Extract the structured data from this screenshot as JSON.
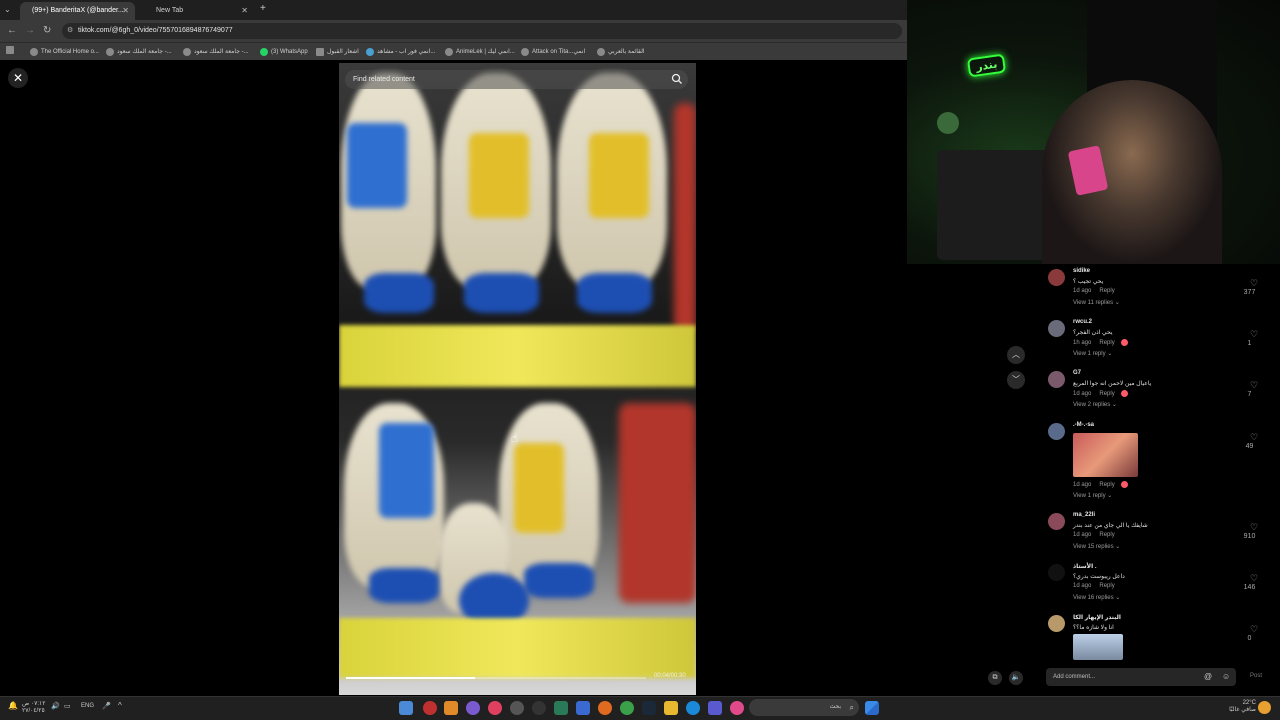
{
  "browser": {
    "tabs": [
      {
        "label": "(99+) BanderitaX (@bander...",
        "active": true
      },
      {
        "label": "New Tab",
        "active": false
      }
    ],
    "url": "tiktok.com/@6gh_0/video/7557016894876749077",
    "bookmarks": [
      "The Official Home o...",
      "جامعة الملك سعود -...",
      "جامعة الملك سعود -...",
      "(3) WhatsApp",
      "اشعار القبول",
      "انمي فور اب - مشاهد...",
      "AnimeLek | انمي ليك...",
      "Attack on Tita...انمي",
      "القائمة بالعربي"
    ]
  },
  "video": {
    "search_placeholder": "Find related content",
    "time": "00:04/00:30",
    "progress": 0.43
  },
  "comments": [
    {
      "user": "sidike",
      "text": "يحي تجيب ؟",
      "age": "1d ago",
      "reply": "Reply",
      "replies": "View 11 replies",
      "likes": "377",
      "avatar_color": "#8a3a3a"
    },
    {
      "user": "rwcu.2",
      "text": "يحي اذن الفجر؟",
      "age": "1h ago",
      "reply": "Reply",
      "replies": "View 1 reply",
      "likes": "1",
      "avatar_color": "#6a6a7a"
    },
    {
      "user": "G7",
      "text": "ياعيال مين لاحمن انه جوا المربع",
      "age": "1d ago",
      "reply": "Reply",
      "replies": "View 2 replies",
      "likes": "7",
      "avatar_color": "#7a5a6a"
    },
    {
      "user": ".-M-.-sa",
      "text": "",
      "age": "1d ago",
      "reply": "Reply",
      "replies": "View 1 reply",
      "likes": "49",
      "avatar_color": "#5a6a8a"
    },
    {
      "user": "ma_22li",
      "text": "شايفك يا الي جاي من عند بندر",
      "age": "1d ago",
      "reply": "Reply",
      "replies": "View 15 replies",
      "likes": "910",
      "avatar_color": "#8a4a5a"
    },
    {
      "user": "الأستاذ .",
      "text": "داعل ريبوست بدري؟",
      "age": "1d ago",
      "reply": "Reply",
      "replies": "View 16 replies",
      "likes": "146",
      "avatar_color": "#111111"
    },
    {
      "user": "البندر الإيهار الكا",
      "text": "انا ولا شازه ما؟؟",
      "age": "",
      "reply": "",
      "replies": "",
      "likes": "0",
      "avatar_color": "#b89a6a"
    }
  ],
  "comment_input": {
    "placeholder": "Add comment...",
    "post": "Post"
  },
  "taskbar": {
    "search_placeholder": "بحث",
    "lang": "ENG",
    "clock_time": "٠٧:١٢ ص",
    "clock_date": "٢٧/٠٤/٢٥",
    "weather_temp": "22°C",
    "weather_text": "صافي غالبًا"
  },
  "webcam": {
    "neon_text": "بندر"
  },
  "colors": {
    "accent": "#fe2c55",
    "page_bg": "#000000",
    "neon": "#33ff3a"
  }
}
